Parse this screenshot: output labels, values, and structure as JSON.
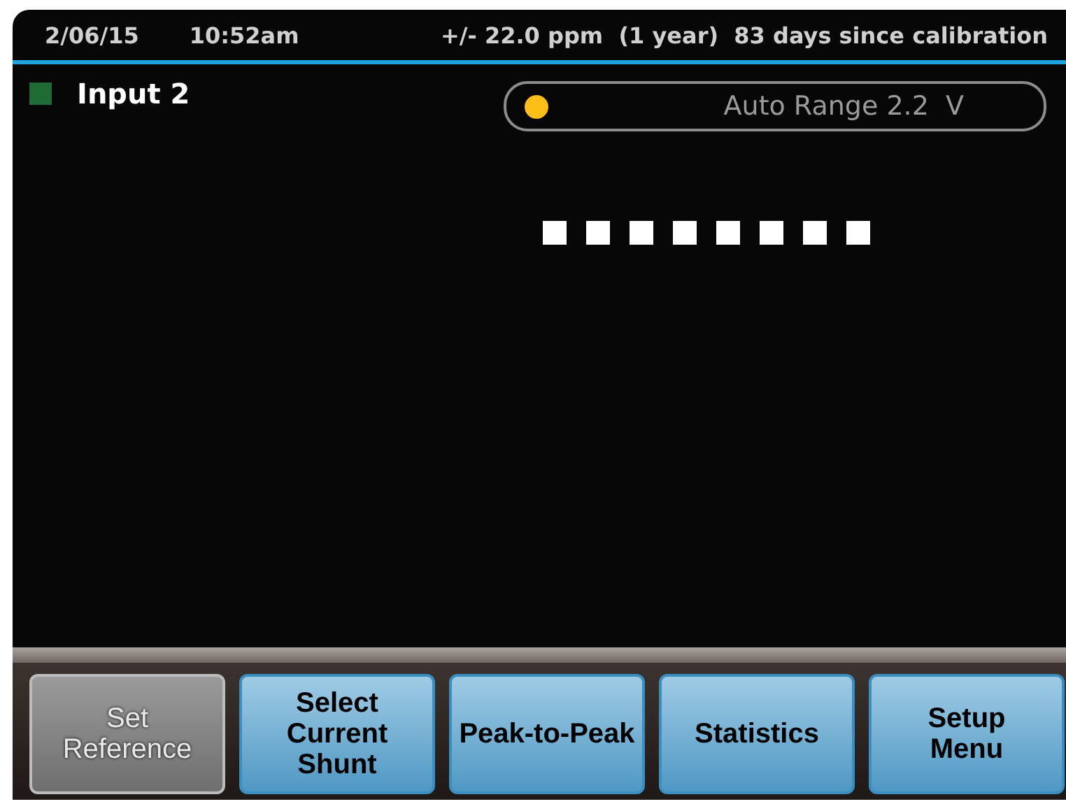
{
  "status_bar": {
    "date": "2/06/15",
    "time": "10:52am",
    "accuracy": "+/- 22.0 ppm  (1 year)  83 days since calibration"
  },
  "input": {
    "label": "Input 2",
    "color": "#1f6b35"
  },
  "range": {
    "label": "Auto Range 2.2  V",
    "color": "#fcbf18"
  },
  "buttons": [
    {
      "label": "Set\nReference",
      "disabled": true
    },
    {
      "label": "Select\nCurrent\nShunt",
      "disabled": false
    },
    {
      "label": "Peak-to-Peak",
      "disabled": false
    },
    {
      "label": "Statistics",
      "disabled": false
    },
    {
      "label": "Setup\nMenu",
      "disabled": false
    }
  ]
}
